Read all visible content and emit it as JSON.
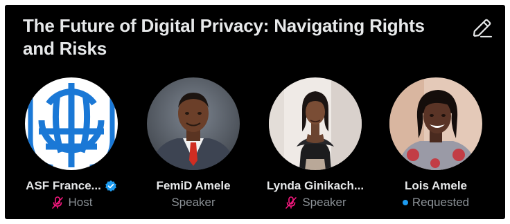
{
  "space": {
    "title": "The Future of Digital Privacy: Navigating Rights and Risks"
  },
  "icons": {
    "edit": "pencil-edit-icon",
    "verified": "verified-badge-icon",
    "mic_off": "microphone-off-icon",
    "requested": "status-dot-icon"
  },
  "colors": {
    "background": "#000000",
    "text_primary": "#e7e9ea",
    "text_secondary": "#8b9196",
    "verified_blue": "#1d9bf0",
    "mic_off_pink": "#f91880",
    "requested_blue": "#1d9bf0",
    "logo_blue": "#1a78d6"
  },
  "participants": [
    {
      "name": "ASF France...",
      "role": "Host",
      "verified": true,
      "muted": true
    },
    {
      "name": "FemiD Amele",
      "role": "Speaker",
      "verified": false,
      "muted": false
    },
    {
      "name": "Lynda Ginikach...",
      "role": "Speaker",
      "verified": false,
      "muted": true
    },
    {
      "name": "Lois Amele",
      "role": "Requested",
      "verified": false,
      "muted": false
    }
  ]
}
